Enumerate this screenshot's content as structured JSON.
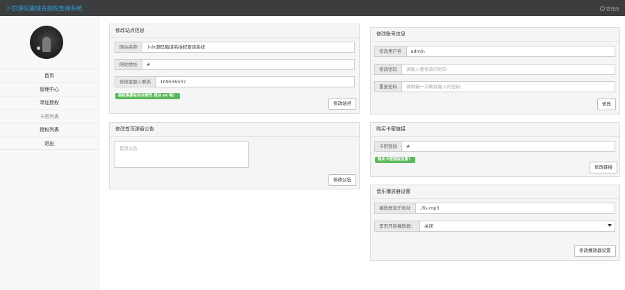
{
  "header": {
    "title": "卜尔源码盾域名授权查询系统",
    "admin_label": "管理员"
  },
  "sidebar": {
    "items": [
      {
        "label": "首页"
      },
      {
        "label": "管理中心"
      },
      {
        "label": "添加授权"
      },
      {
        "label": "卡密列表"
      },
      {
        "label": "授权列表"
      },
      {
        "label": "退出"
      }
    ]
  },
  "site_settings": {
    "title": "修改站点信息",
    "name_label": "网站名称",
    "name_value": "卜尔源码盾域名授权查询系统",
    "url_label": "网站地址",
    "url_value": "#",
    "qq_label": "修改客服人联系",
    "qq_value": "109536537",
    "badge": "授权客服在后台修改 成功 ok 啦！",
    "button": "修改站点"
  },
  "announcement": {
    "title": "修改首页弹窗公告",
    "placeholder": "首页公告",
    "button": "修改公告"
  },
  "account": {
    "title": "修改账号信息",
    "user_label": "修改用户名",
    "user_value": "admin",
    "pwd_label": "修改密码",
    "pwd_placeholder": "请输入要修改的密码",
    "confirm_label": "重复密码",
    "confirm_placeholder": "请再输一次确保输入的密码",
    "button": "修改"
  },
  "card_link": {
    "title": "购买卡密链接",
    "label": "卡密链接",
    "value": "#",
    "badge": "购买卡密链接设置！",
    "button": "修改链接"
  },
  "music": {
    "title": "音乐播放器设置",
    "url_label": "播放器音乐地址",
    "url_value": "./lis.mp3",
    "toggle_label": "是否开启播放器：",
    "toggle_value": "关闭",
    "button": "修改播放器设置"
  }
}
